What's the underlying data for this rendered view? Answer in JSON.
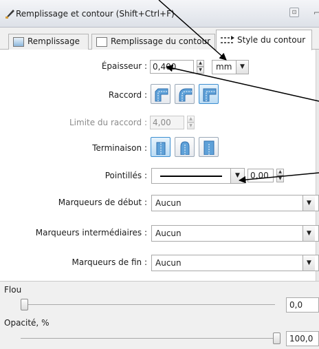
{
  "window": {
    "title": "Remplissage et contour (Shift+Ctrl+F)",
    "pin_button": "⊡",
    "extra_glyph": "⌐"
  },
  "tabs": [
    {
      "label": "Remplissage",
      "icon": "fill-swatch-icon",
      "active": false
    },
    {
      "label": "Remplissage du contour",
      "icon": "stroke-paint-swatch-icon",
      "active": false
    },
    {
      "label": "Style du contour",
      "icon": "stroke-style-icon",
      "active": true
    }
  ],
  "stroke_style": {
    "width_label": "Épaisseur :",
    "width_value": "0,400",
    "unit": "mm",
    "join_label": "Raccord :",
    "join_options": [
      "bevel-join-icon",
      "round-join-icon",
      "miter-join-icon"
    ],
    "join_selected": "miter-join-icon",
    "miter_label": "Limite du raccord :",
    "miter_value": "4,00",
    "cap_label": "Terminaison :",
    "cap_options": [
      "butt-cap-icon",
      "round-cap-icon",
      "square-cap-icon"
    ],
    "cap_selected": "butt-cap-icon",
    "dash_label": "Pointillés :",
    "dash_offset": "0,00",
    "start_markers_label": "Marqueurs de début :",
    "start_markers_value": "Aucun",
    "mid_markers_label": "Marqueurs intermédiaires :",
    "mid_markers_value": "Aucun",
    "end_markers_label": "Marqueurs de fin :",
    "end_markers_value": "Aucun"
  },
  "blur": {
    "label": "Flou",
    "value": "0,0",
    "level": 0
  },
  "opacity": {
    "label": "Opacité, %",
    "value": "100,0",
    "level": 100
  },
  "colors": {
    "active_toggle": "#bcdcf4",
    "icon_accent": "#2f7fc4",
    "annotation_arrow": "#000000"
  }
}
